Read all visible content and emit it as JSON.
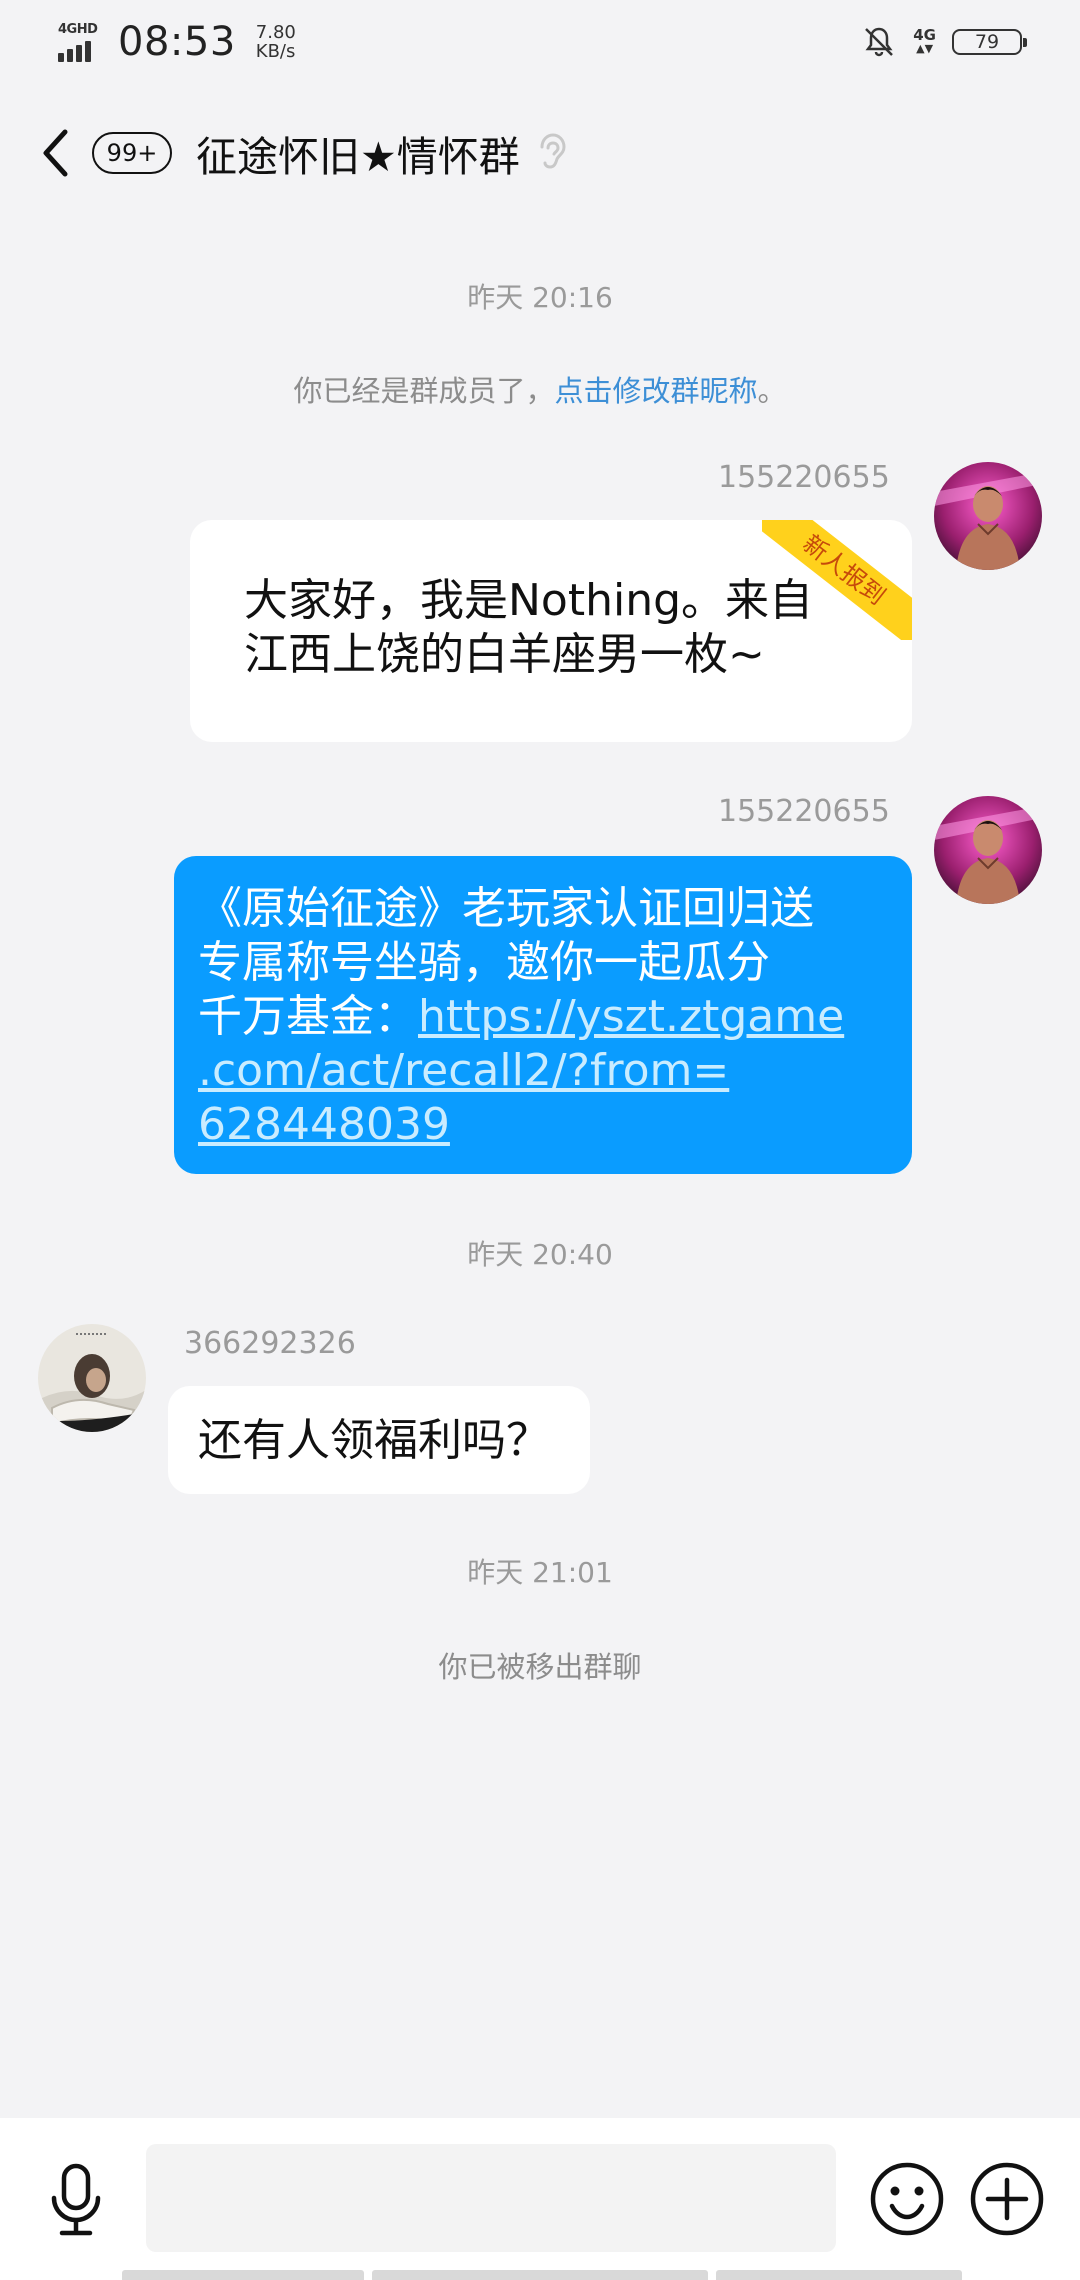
{
  "status_bar": {
    "network_type": "4GHD",
    "time": "08:53",
    "speed_value": "7.80",
    "speed_unit": "KB/s",
    "mobile_data": "4G",
    "battery": "79"
  },
  "header": {
    "unread_count": "99+",
    "title": "征途怀旧★情怀群"
  },
  "messages": {
    "ts1": "昨天 20:16",
    "sys1_text": "你已经是群成员了，",
    "sys1_link": "点击修改群昵称",
    "sys1_end": "。",
    "m1_sender": "155220655",
    "m1_badge": "新人报到",
    "m1_line1": "大家好，我是Nothing。来自",
    "m1_line2": "江西上饶的白羊座男一枚~",
    "m2_sender": "155220655",
    "m2_line1": "《原始征途》老玩家认证回归送",
    "m2_line2": "专属称号坐骑，邀你一起瓜分",
    "m2_line3": "千万基金：",
    "m2_link1": "https://yszt.ztgame",
    "m2_link2": ".com/act/recall2/?from=",
    "m2_link3": "628448039",
    "ts2": "昨天 20:40",
    "m3_sender": "366292326",
    "m3_text": "还有人领福利吗？",
    "ts3": "昨天 21:01",
    "sys2_text": "你已被移出群聊"
  },
  "input_bar": {
    "placeholder": ""
  },
  "colors": {
    "background": "#f3f3f5",
    "blue_bubble": "#0a9cff",
    "link": "#3d8fd6",
    "badge": "#ffd11c"
  }
}
